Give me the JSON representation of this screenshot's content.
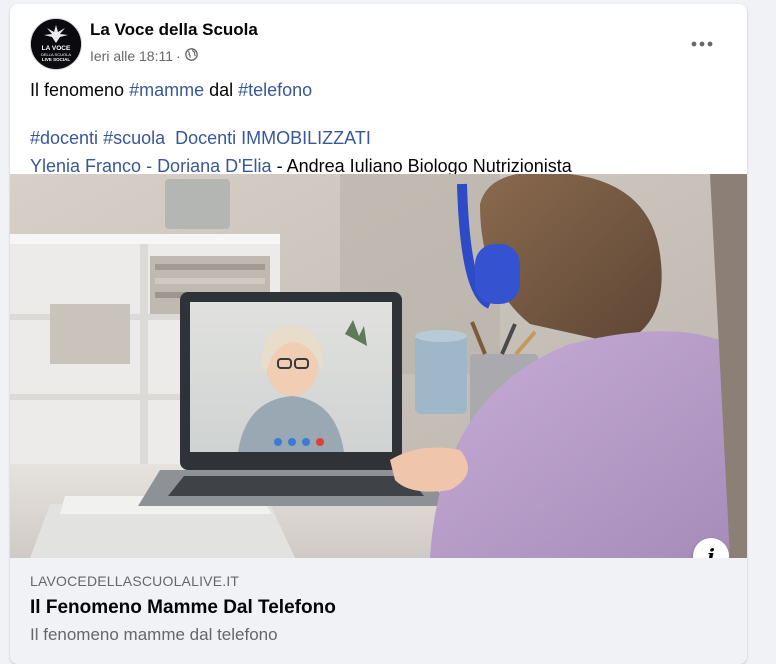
{
  "post": {
    "page_name": "La Voce della Scuola",
    "timestamp": "Ieri alle 18:11",
    "separator": "·",
    "avatar_text": [
      "LA VOCE",
      "DELLA SCUOLA",
      "LIVE SOCIAL"
    ],
    "line1": {
      "prefix": "Il fenomeno ",
      "hashtag1": "#mamme",
      "middle": " dal ",
      "hashtag2": "#telefono"
    },
    "line2": {
      "hashtag1": "#docenti",
      "hashtag2": "#scuola",
      "link": "Docenti IMMOBILIZZATI"
    },
    "line3": {
      "person1": "Ylenia Franco",
      "dash1": " - ",
      "person2": "Doriana D'Elia",
      "rest": " - Andrea Iuliano Biologo Nutrizionista"
    }
  },
  "link_preview": {
    "domain": "LAVOCEDELLASCUOLALIVE.IT",
    "title": "Il Fenomeno Mamme Dal Telefono",
    "description": "Il fenomeno mamme dal telefono"
  },
  "icons": {
    "more": "more-options-icon",
    "audience": "globe-icon",
    "info": "info-icon"
  },
  "colors": {
    "link": "#385898",
    "secondary_text": "#65676b",
    "preview_bg": "#f0f2f5"
  },
  "info_glyph": "i"
}
